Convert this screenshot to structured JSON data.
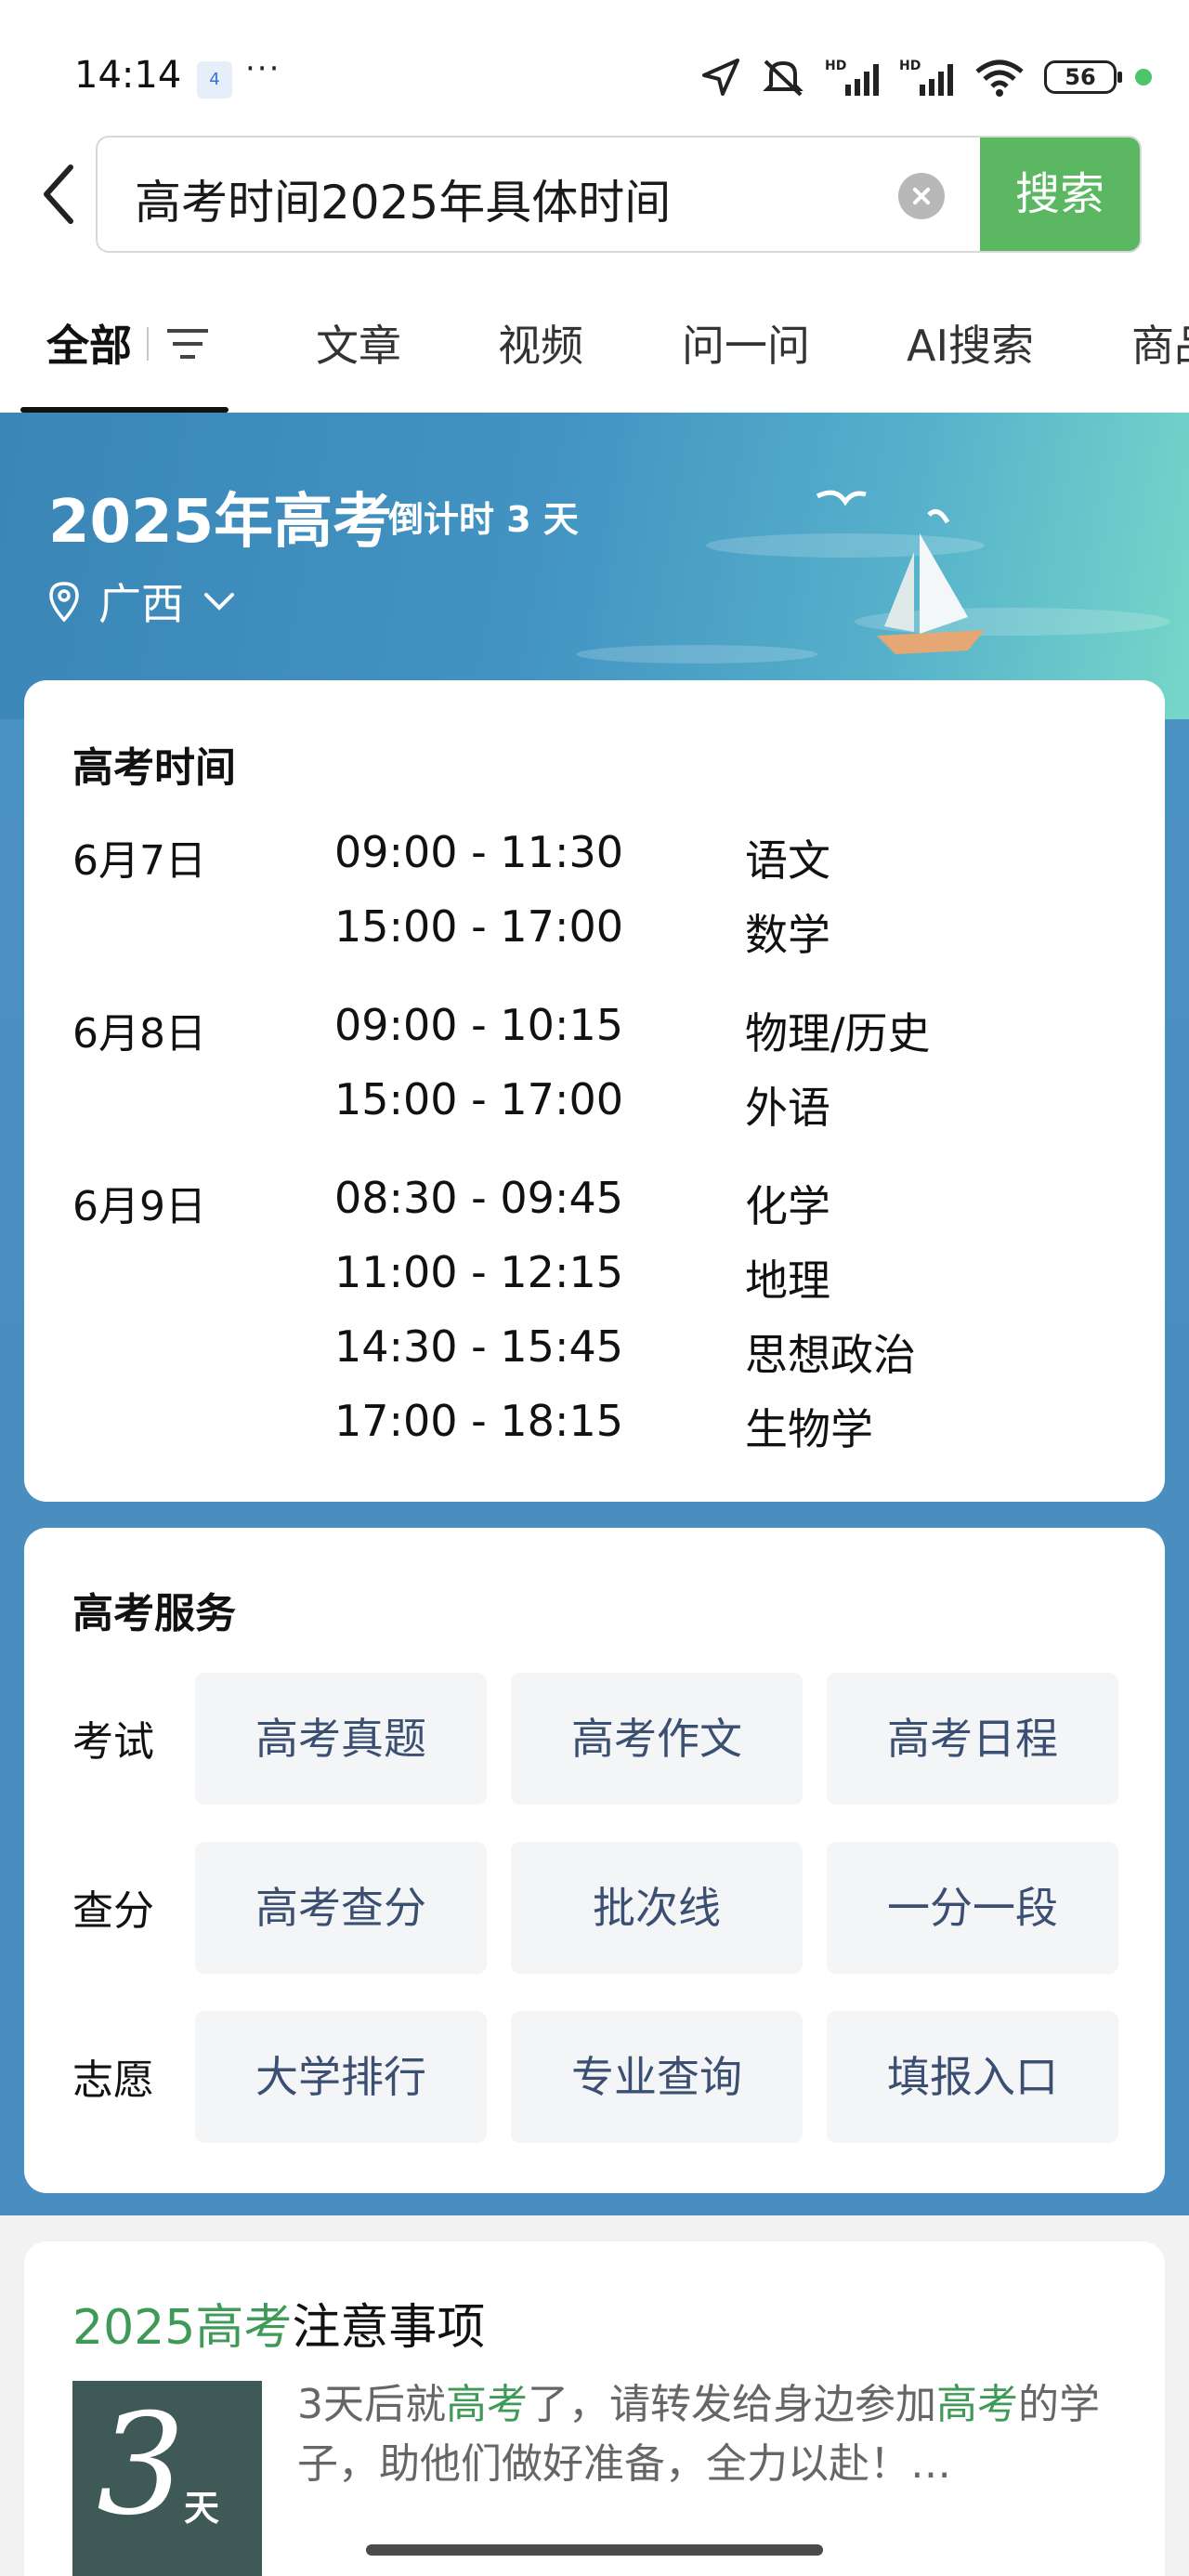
{
  "status_bar": {
    "time": "14:14",
    "notification_badge": "4",
    "more": "···",
    "battery": "56",
    "icons": [
      "location-icon",
      "mute-icon",
      "signal-hd-icon",
      "signal-hd-icon",
      "wifi-icon",
      "battery-icon"
    ]
  },
  "search": {
    "query": "高考时间2025年具体时间",
    "button_label": "搜索"
  },
  "tabs": [
    {
      "label": "全部",
      "active": true
    },
    {
      "label": "文章"
    },
    {
      "label": "视频"
    },
    {
      "label": "问一问"
    },
    {
      "label": "AI搜索"
    },
    {
      "label": "商品"
    }
  ],
  "hero": {
    "title": "2025年高考",
    "countdown": "倒计时 3 天",
    "location": "广西"
  },
  "schedule": {
    "title": "高考时间",
    "rows": [
      {
        "date": "6月7日",
        "time": "09:00 - 11:30",
        "subject": "语文"
      },
      {
        "date": "",
        "time": "15:00 - 17:00",
        "subject": "数学"
      },
      {
        "date": "6月8日",
        "time": "09:00 - 10:15",
        "subject": "物理/历史"
      },
      {
        "date": "",
        "time": "15:00 - 17:00",
        "subject": "外语"
      },
      {
        "date": "6月9日",
        "time": "08:30 - 09:45",
        "subject": "化学"
      },
      {
        "date": "",
        "time": "11:00 - 12:15",
        "subject": "地理"
      },
      {
        "date": "",
        "time": "14:30 - 15:45",
        "subject": "思想政治"
      },
      {
        "date": "",
        "time": "17:00 - 18:15",
        "subject": "生物学"
      }
    ]
  },
  "services": {
    "title": "高考服务",
    "groups": [
      {
        "label": "考试",
        "items": [
          "高考真题",
          "高考作文",
          "高考日程"
        ]
      },
      {
        "label": "查分",
        "items": [
          "高考查分",
          "批次线",
          "一分一段"
        ]
      },
      {
        "label": "志愿",
        "items": [
          "大学排行",
          "专业查询",
          "填报入口"
        ]
      }
    ]
  },
  "article": {
    "title_highlight": "2025高考",
    "title_rest": "注意事项",
    "thumb_big": "3",
    "thumb_small": "天",
    "body_1": "3天后就",
    "body_hl_1": "高考",
    "body_2": "了，请转发给身边参加",
    "body_hl_2": "高考",
    "body_3": "的学子，助他们做好准备，全力以赴！…"
  },
  "colors": {
    "accent_green": "#5bb761",
    "hero_blue": "#4a8fc0",
    "service_text": "#3a4f72",
    "highlight_green": "#3f9a57"
  }
}
